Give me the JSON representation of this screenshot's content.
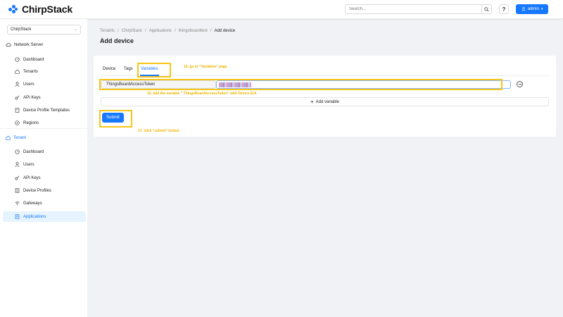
{
  "header": {
    "brand": "ChirpStack",
    "search_placeholder": "Search...",
    "help_label": "?",
    "user_label": "admin"
  },
  "sidebar": {
    "tenant_select": "ChirpStack",
    "network_server_label": "Network Server",
    "network_items": [
      {
        "label": "Dashboard",
        "icon": "dashboard-icon"
      },
      {
        "label": "Tenants",
        "icon": "home-icon"
      },
      {
        "label": "Users",
        "icon": "user-icon"
      },
      {
        "label": "API Keys",
        "icon": "key-icon"
      },
      {
        "label": "Device Profile Templates",
        "icon": "template-icon"
      },
      {
        "label": "Regions",
        "icon": "compass-icon"
      }
    ],
    "tenant_label": "Tenant",
    "tenant_items": [
      {
        "label": "Dashboard",
        "icon": "dashboard-icon"
      },
      {
        "label": "Users",
        "icon": "user-icon"
      },
      {
        "label": "API Keys",
        "icon": "key-icon"
      },
      {
        "label": "Device Profiles",
        "icon": "profile-icon"
      },
      {
        "label": "Gateways",
        "icon": "wifi-icon"
      },
      {
        "label": "Applications",
        "icon": "apps-icon"
      }
    ]
  },
  "breadcrumb": [
    "Tenants",
    "ChirpStack",
    "Applications",
    "thingsboardtest",
    "Add device"
  ],
  "page_title": "Add device",
  "tabs": [
    "Device",
    "Tags",
    "Variables"
  ],
  "variable": {
    "key": "ThingsBoardAccessToken"
  },
  "add_variable_label": "Add variable",
  "submit_label": "Submit",
  "annotations": {
    "step15": "15. go to \"Variables\" page",
    "step16": "16. add the variable \" ThingsBoardAccessToken\" with Device EUI",
    "step17": "17. click \"submit\" button"
  },
  "colors": {
    "accent": "#1677ff",
    "highlight": "#f5c518"
  }
}
